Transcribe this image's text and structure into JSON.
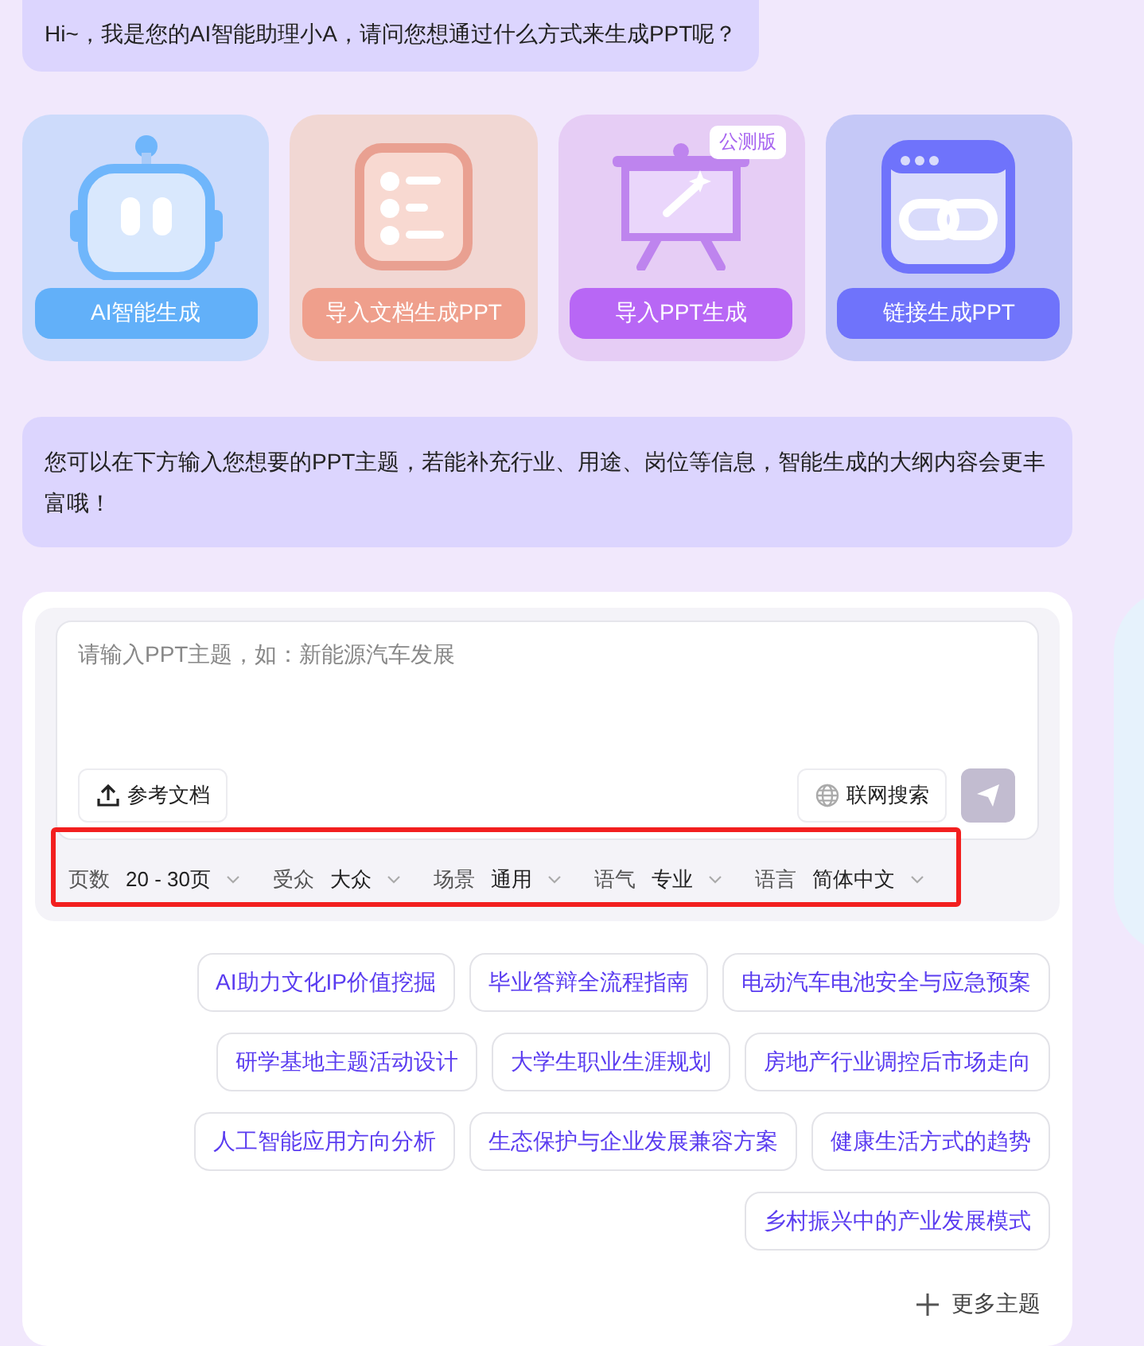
{
  "greeting": "Hi~，我是您的AI智能助理小A，请问您想通过什么方式来生成PPT呢？",
  "modes": [
    {
      "kind": "robot",
      "label": "AI智能生成",
      "color": "#62b0f9"
    },
    {
      "kind": "document",
      "label": "导入文档生成PPT",
      "color": "#ef9f8c"
    },
    {
      "kind": "presentation",
      "label": "导入PPT生成",
      "color": "#b867f5",
      "badge": "公测版"
    },
    {
      "kind": "link",
      "label": "链接生成PPT",
      "color": "#6f73fb"
    }
  ],
  "hint": "您可以在下方输入您想要的PPT主题，若能补充行业、用途、岗位等信息，智能生成的大纲内容会更丰富哦！",
  "input": {
    "placeholder": "请输入PPT主题，如：新能源汽车发展",
    "attach_label": "参考文档",
    "web_search_label": "联网搜索",
    "web_search_on": false
  },
  "options": [
    {
      "label": "页数",
      "value": "20 - 30页"
    },
    {
      "label": "受众",
      "value": "大众"
    },
    {
      "label": "场景",
      "value": "通用"
    },
    {
      "label": "语气",
      "value": "专业"
    },
    {
      "label": "语言",
      "value": "简体中文"
    }
  ],
  "topic_rows": [
    [
      "AI助力文化IP价值挖掘",
      "毕业答辩全流程指南",
      "电动汽车电池安全与应急预案"
    ],
    [
      "研学基地主题活动设计",
      "大学生职业生涯规划",
      "房地产行业调控后市场走向"
    ],
    [
      "人工智能应用方向分析",
      "生态保护与企业发展兼容方案",
      "健康生活方式的趋势"
    ],
    [
      "乡村振兴中的产业发展模式"
    ]
  ],
  "more_topics": "更多主题"
}
